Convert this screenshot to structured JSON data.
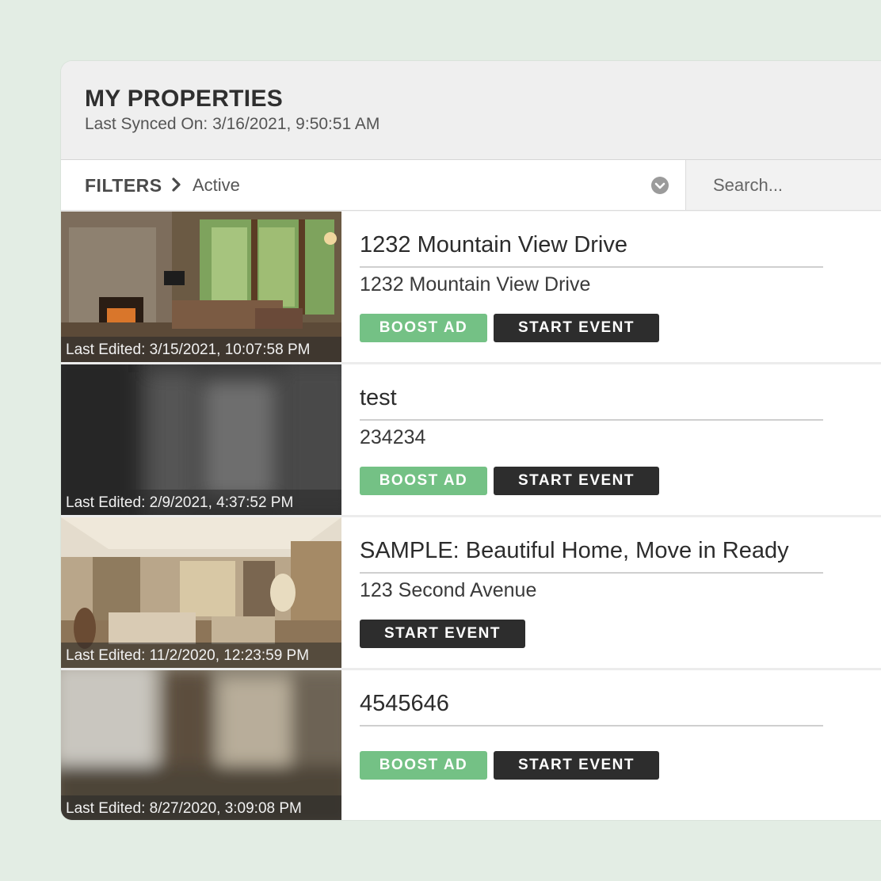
{
  "header": {
    "title": "MY PROPERTIES",
    "last_synced": "Last Synced On: 3/16/2021, 9:50:51 AM"
  },
  "filters": {
    "label": "FILTERS",
    "value": "Active"
  },
  "search": {
    "placeholder": "Search..."
  },
  "properties": [
    {
      "title": "1232 Mountain View Drive",
      "subtitle": "1232 Mountain View Drive",
      "last_edited": "Last Edited: 3/15/2021, 10:07:58 PM",
      "boost_label": "BOOST AD",
      "event_label": "START EVENT"
    },
    {
      "title": "test",
      "subtitle": "234234",
      "last_edited": "Last Edited: 2/9/2021, 4:37:52 PM",
      "boost_label": "BOOST AD",
      "event_label": "START EVENT"
    },
    {
      "title": "SAMPLE: Beautiful Home, Move in Ready",
      "subtitle": "123 Second Avenue",
      "last_edited": "Last Edited: 11/2/2020, 12:23:59 PM",
      "event_label": "START EVENT"
    },
    {
      "title": "4545646",
      "last_edited": "Last Edited: 8/27/2020, 3:09:08 PM",
      "boost_label": "BOOST AD",
      "event_label": "START EVENT"
    }
  ],
  "colors": {
    "background": "#e3ede4",
    "boost": "#74c185",
    "event": "#2d2d2d"
  },
  "icons": {
    "filter_chevron": "chevron-right-icon",
    "dropdown": "chevron-down-circle-icon"
  }
}
